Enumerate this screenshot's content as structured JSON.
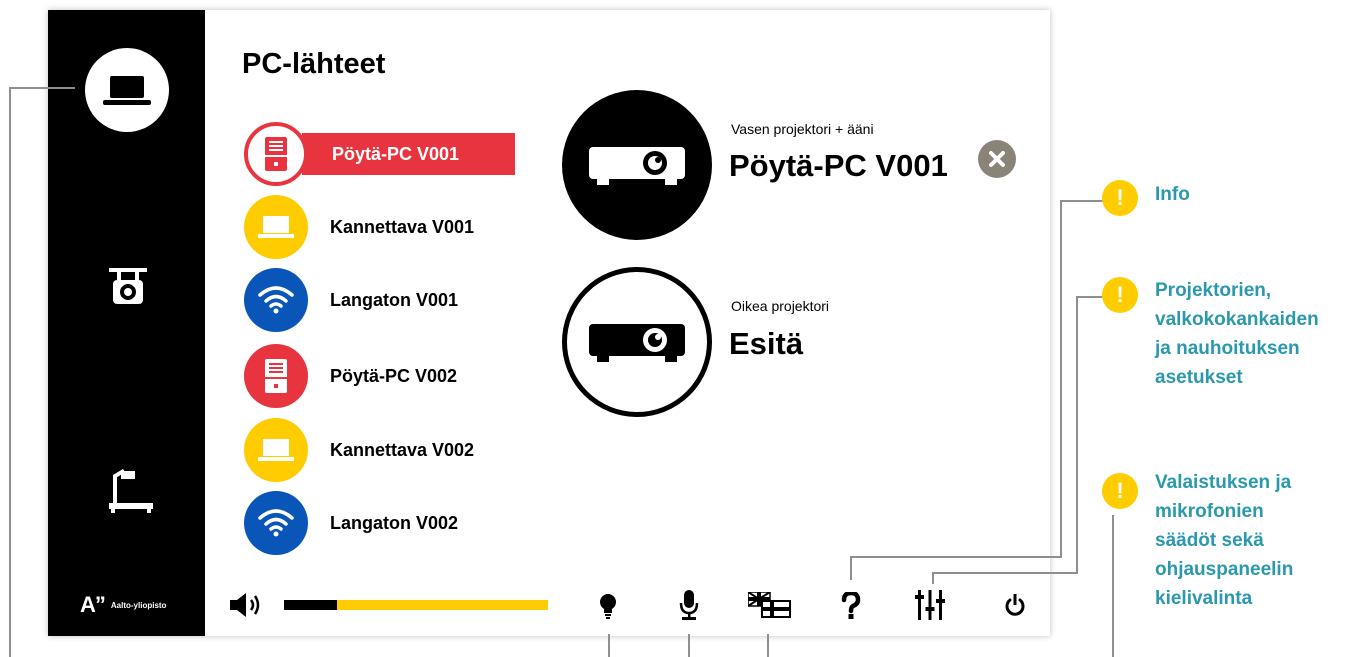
{
  "colors": {
    "red": "#e8343f",
    "yellow": "#ffcc00",
    "blue": "#0a56b8",
    "note_teal": "#2a98ad",
    "close_grey": "#8a8378"
  },
  "sidebar": {
    "items": [
      {
        "icon": "laptop-icon",
        "active": true
      },
      {
        "icon": "ceiling-projector-icon",
        "active": false
      },
      {
        "icon": "document-camera-icon",
        "active": false
      }
    ],
    "logo": {
      "mark": "A”",
      "text": "Aalto-yliopisto"
    }
  },
  "page_title": "PC-lähteet",
  "sources": [
    {
      "label": "Pöytä-PC V001",
      "icon": "desktop-pc-icon",
      "color": "red",
      "selected": true
    },
    {
      "label": "Kannettava V001",
      "icon": "laptop-icon",
      "color": "yellow",
      "selected": false
    },
    {
      "label": "Langaton V001",
      "icon": "wifi-icon",
      "color": "blue",
      "selected": false
    },
    {
      "label": "Pöytä-PC V002",
      "icon": "desktop-pc-icon",
      "color": "red",
      "selected": false
    },
    {
      "label": "Kannettava V002",
      "icon": "laptop-icon",
      "color": "yellow",
      "selected": false
    },
    {
      "label": "Langaton V002",
      "icon": "wifi-icon",
      "color": "blue",
      "selected": false
    }
  ],
  "projectors": [
    {
      "subtitle": "Vasen projektori + ääni",
      "value": "Pöytä-PC V001",
      "close_icon": "close-icon"
    },
    {
      "subtitle": "Oikea projektori",
      "value": "Esitä"
    }
  ],
  "bottom_bar": {
    "volume_icon": "speaker-icon",
    "volume_level": 0.2,
    "buttons": [
      "lightbulb-icon",
      "microphone-icon",
      "language-flag-icon",
      "help-icon",
      "mixer-settings-icon",
      "power-icon"
    ]
  },
  "annotations": [
    {
      "marker": "!",
      "text": "Info"
    },
    {
      "marker": "!",
      "text": "Projektorien,\nvalkokokankaiden\nja nauhoituksen\nasetukset"
    },
    {
      "marker": "!",
      "text": "Valaistuksen ja\nmikrofonien\nsäädöt sekä\nohjauspaneelin\nkielivalinta"
    }
  ]
}
